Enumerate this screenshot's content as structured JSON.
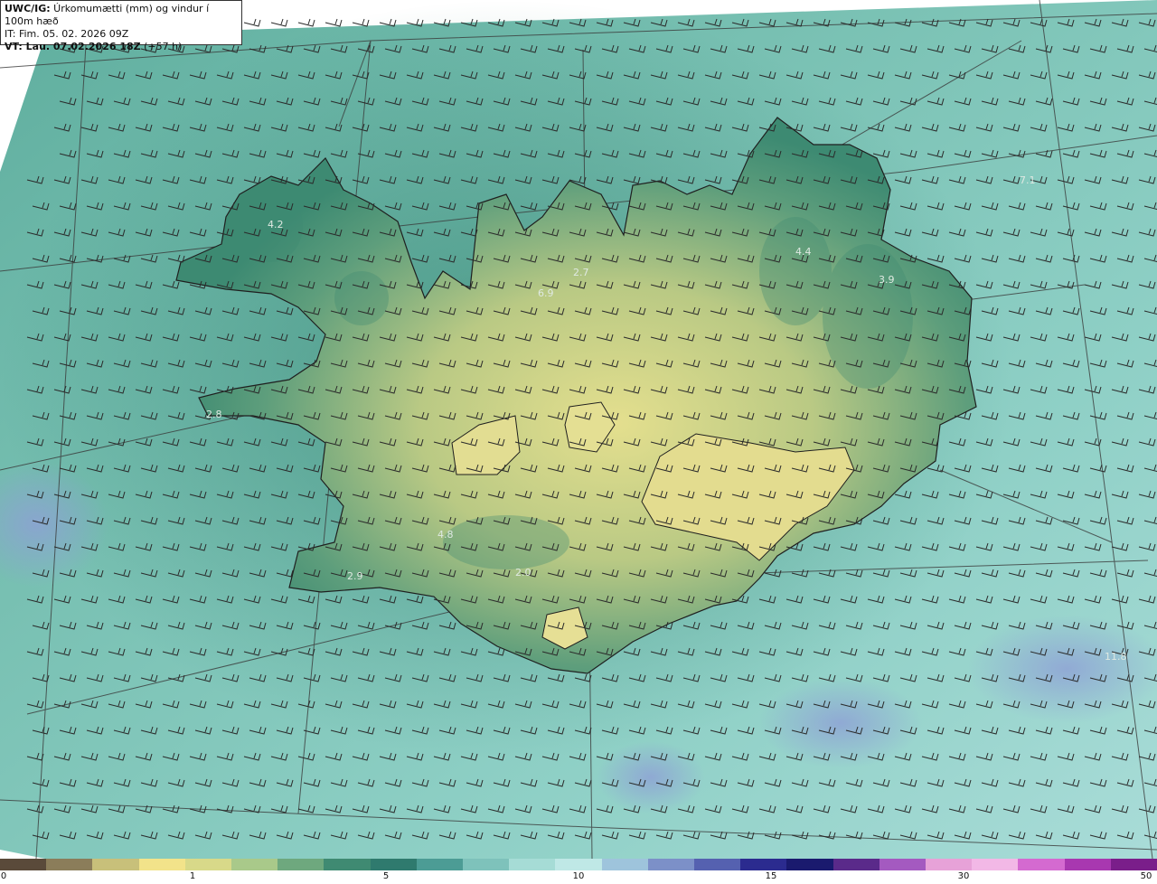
{
  "header": {
    "title_prefix": "UWC/IG:",
    "title_rest": " Úrkomumætti (mm) og vindur í 100m hæð",
    "it_line": "IT: Fim. 05. 02. 2026 09Z",
    "vt_prefix": "VT: Lau. 07.02.2026 18Z",
    "vt_suffix": " (+57 h)"
  },
  "value_labels": [
    "4.2",
    "2.7",
    "6.9",
    "4.4",
    "3.9",
    "7.1",
    "2.8",
    "4.8",
    "2.9",
    "2.0",
    "11.8"
  ],
  "colorbar": {
    "ticks": [
      "0",
      "1",
      "5",
      "10",
      "15",
      "30",
      "50"
    ],
    "colors": [
      "#5a4a3a",
      "#8b7d5a",
      "#c8c07a",
      "#f2e38a",
      "#d8d989",
      "#a9c98a",
      "#6ea87e",
      "#3f8a72",
      "#2f7a6e",
      "#4c9c95",
      "#7ec2bb",
      "#a6dcd6",
      "#bfe8e6",
      "#9ec4dc",
      "#7c90c8",
      "#5561b0",
      "#2b2b8f",
      "#1a1a6e",
      "#5a2a8a",
      "#a45ac0",
      "#e7a2d8",
      "#f2b8e6",
      "#d46ad0",
      "#a838b0",
      "#7a1e8a"
    ]
  },
  "colors": {
    "sea": "#8fd0c6",
    "land_low": "#3f8f78",
    "land_high": "#d8d88a",
    "coast": "#1f1f1f",
    "grid": "#3a3a3a",
    "barb": "#2a2a2a"
  },
  "icons": [
    "wind-barb-icon"
  ]
}
